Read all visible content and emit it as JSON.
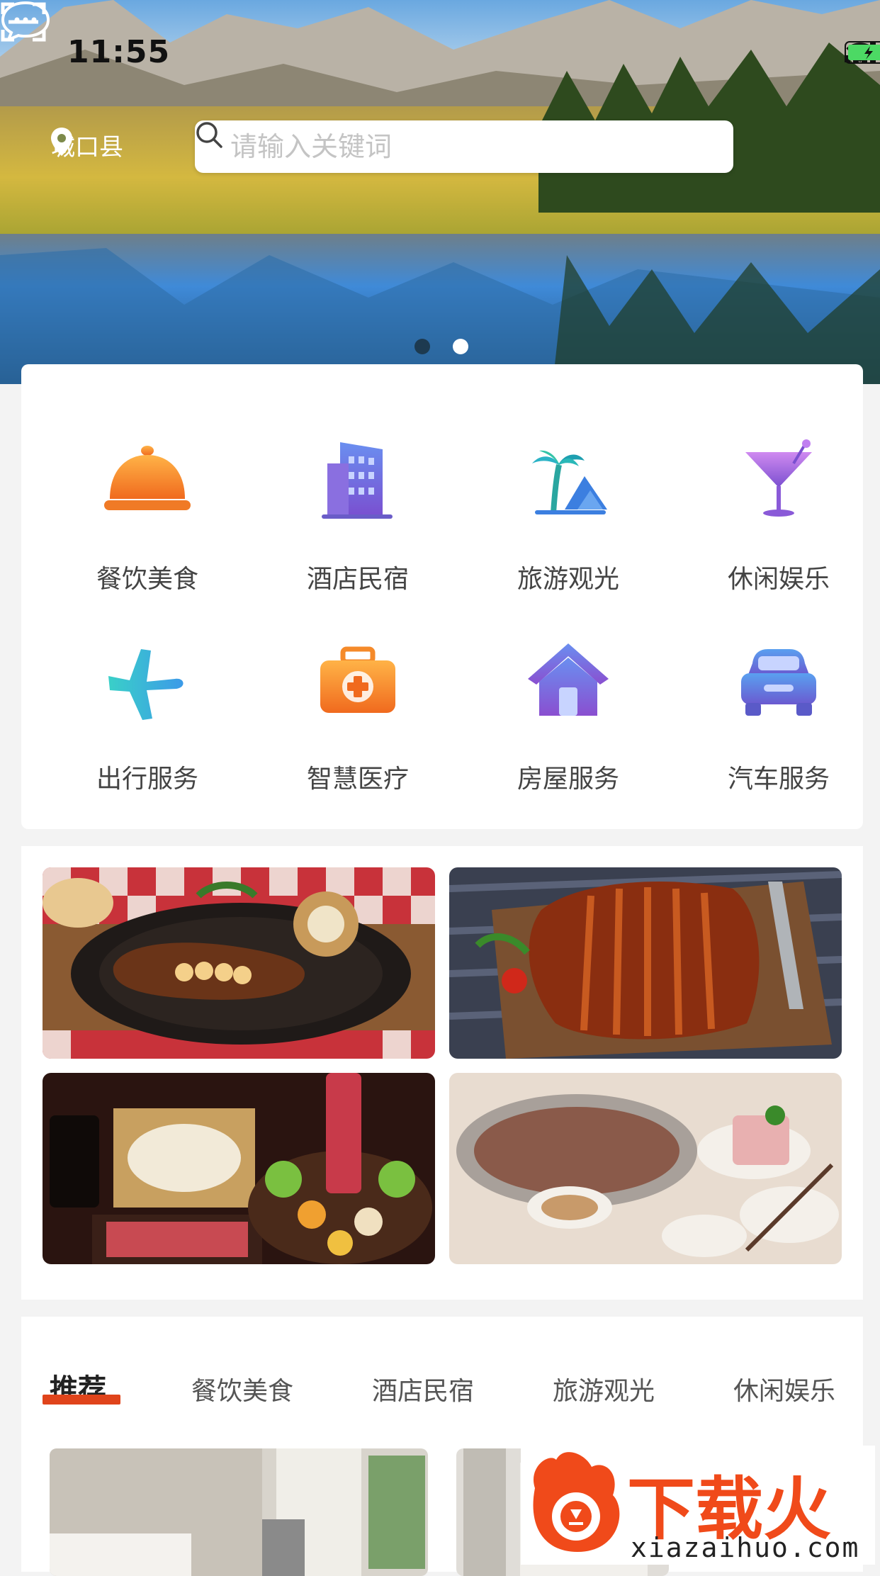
{
  "status_bar": {
    "time": "11:55"
  },
  "header": {
    "location": "城口县",
    "search_placeholder": "请输入关键词"
  },
  "banner": {
    "slides": 2,
    "active_index": 1
  },
  "categories": [
    {
      "label": "餐饮美食",
      "icon": "cloche-icon"
    },
    {
      "label": "酒店民宿",
      "icon": "building-icon"
    },
    {
      "label": "旅游观光",
      "icon": "palm-tree-icon"
    },
    {
      "label": "休闲娱乐",
      "icon": "cocktail-icon"
    },
    {
      "label": "出行服务",
      "icon": "airplane-icon"
    },
    {
      "label": "智慧医疗",
      "icon": "medical-kit-icon"
    },
    {
      "label": "房屋服务",
      "icon": "house-icon"
    },
    {
      "label": "汽车服务",
      "icon": "car-icon"
    }
  ],
  "food_images": [
    "steak-image",
    "roast-pork-image",
    "hotpot-ingredients-image",
    "hotpot-table-image"
  ],
  "tabs": [
    {
      "label": "推荐",
      "active": true
    },
    {
      "label": "餐饮美食",
      "active": false
    },
    {
      "label": "酒店民宿",
      "active": false
    },
    {
      "label": "旅游观光",
      "active": false
    },
    {
      "label": "休闲娱乐",
      "active": false
    }
  ],
  "watermark": {
    "brand": "下载火",
    "url": "xiazaihuo.com"
  },
  "colors": {
    "accent": "#e0441b",
    "orange": "#f58a2a",
    "purple": "#7a4fd0",
    "blue": "#3c7fe0",
    "teal": "#2bb3c6"
  }
}
